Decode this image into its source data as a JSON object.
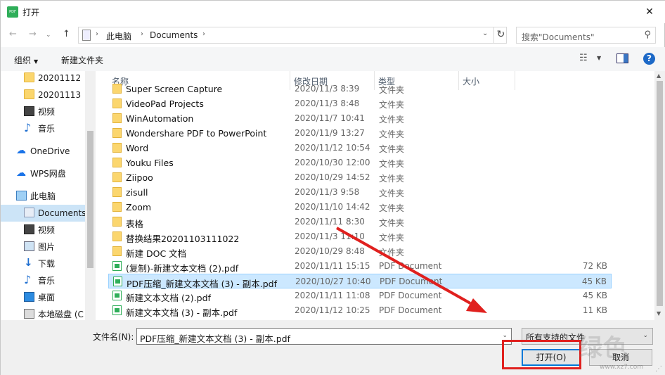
{
  "window": {
    "title": "打开",
    "close": "✕"
  },
  "address": {
    "crumbs": [
      "此电脑",
      "Documents"
    ],
    "search_placeholder": "搜索\"Documents\""
  },
  "toolbar": {
    "organize": "组织",
    "new_folder": "新建文件夹"
  },
  "nav": {
    "items": [
      {
        "label": "20201112",
        "icon": "folder-icon"
      },
      {
        "label": "20201113",
        "icon": "folder-icon"
      },
      {
        "label": "视频",
        "icon": "video-icon"
      },
      {
        "label": "音乐",
        "icon": "music-icon"
      },
      {
        "label": "OneDrive",
        "icon": "cloud-icon"
      },
      {
        "label": "WPS网盘",
        "icon": "wps-cloud-icon"
      },
      {
        "label": "此电脑",
        "icon": "pc-icon"
      },
      {
        "label": "Documents",
        "icon": "documents-icon"
      },
      {
        "label": "视频",
        "icon": "video-icon"
      },
      {
        "label": "图片",
        "icon": "pictures-icon"
      },
      {
        "label": "下载",
        "icon": "download-icon"
      },
      {
        "label": "音乐",
        "icon": "music-icon"
      },
      {
        "label": "桌面",
        "icon": "desktop-icon"
      },
      {
        "label": "本地磁盘 (C",
        "icon": "disk-icon"
      }
    ]
  },
  "columns": {
    "name": "名称",
    "date": "修改日期",
    "type": "类型",
    "size": "大小"
  },
  "files": [
    {
      "name": "Super Screen Capture",
      "date": "2020/11/3 8:39",
      "type": "文件夹",
      "size": "",
      "kind": "folder"
    },
    {
      "name": "VideoPad Projects",
      "date": "2020/11/3 8:48",
      "type": "文件夹",
      "size": "",
      "kind": "folder"
    },
    {
      "name": "WinAutomation",
      "date": "2020/11/7 10:41",
      "type": "文件夹",
      "size": "",
      "kind": "folder"
    },
    {
      "name": "Wondershare PDF to PowerPoint",
      "date": "2020/11/9 13:27",
      "type": "文件夹",
      "size": "",
      "kind": "folder"
    },
    {
      "name": "Word",
      "date": "2020/11/12 10:54",
      "type": "文件夹",
      "size": "",
      "kind": "folder"
    },
    {
      "name": "Youku Files",
      "date": "2020/10/30 12:00",
      "type": "文件夹",
      "size": "",
      "kind": "folder"
    },
    {
      "name": "Ziipoo",
      "date": "2020/10/29 14:52",
      "type": "文件夹",
      "size": "",
      "kind": "folder"
    },
    {
      "name": "zisull",
      "date": "2020/11/3 9:58",
      "type": "文件夹",
      "size": "",
      "kind": "folder"
    },
    {
      "name": "Zoom",
      "date": "2020/11/10 14:42",
      "type": "文件夹",
      "size": "",
      "kind": "folder"
    },
    {
      "name": "表格",
      "date": "2020/11/11 8:30",
      "type": "文件夹",
      "size": "",
      "kind": "folder"
    },
    {
      "name": "替换结果20201103111022",
      "date": "2020/11/3 11:10",
      "type": "文件夹",
      "size": "",
      "kind": "folder"
    },
    {
      "name": "新建 DOC 文档",
      "date": "2020/10/29 8:48",
      "type": "文件夹",
      "size": "",
      "kind": "folder"
    },
    {
      "name": "(复制)-新建文本文档 (2).pdf",
      "date": "2020/11/11 15:15",
      "type": "PDF Document",
      "size": "72 KB",
      "kind": "pdf"
    },
    {
      "name": "PDF压缩_新建文本文档 (3) - 副本.pdf",
      "date": "2020/10/27 10:40",
      "type": "PDF Document",
      "size": "45 KB",
      "kind": "pdf",
      "selected": true
    },
    {
      "name": "新建文本文档 (2).pdf",
      "date": "2020/11/11 11:08",
      "type": "PDF Document",
      "size": "45 KB",
      "kind": "pdf"
    },
    {
      "name": "新建文本文档 (3) - 副本.pdf",
      "date": "2020/11/12 10:25",
      "type": "PDF Document",
      "size": "11 KB",
      "kind": "pdf"
    }
  ],
  "bottom": {
    "filename_label": "文件名(N):",
    "filename_value": "PDF压缩_新建文本文档 (3) - 副本.pdf",
    "filter": "所有支持的文件",
    "open": "打开(O)",
    "cancel": "取消"
  },
  "watermark": {
    "text": "绿色",
    "url": "www.xz7.com"
  },
  "colors": {
    "accent": "#0078d7",
    "selection": "#cce8ff",
    "annotation": "#e0201e",
    "pdf_brand": "#2fae59"
  }
}
